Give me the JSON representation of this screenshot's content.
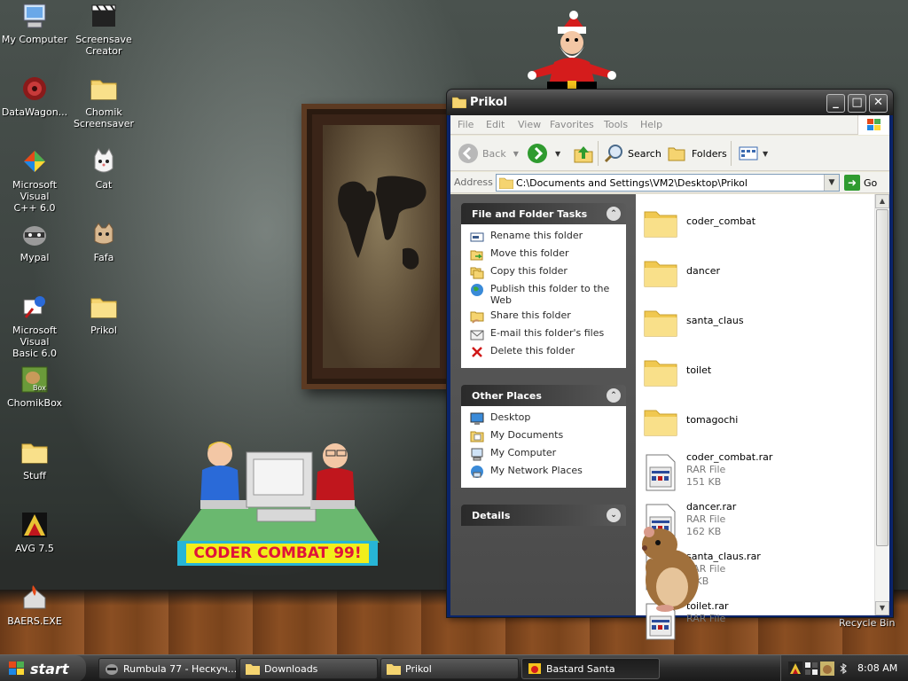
{
  "desktop": {
    "icons": [
      {
        "label": "My Computer",
        "icon": "my-computer-icon"
      },
      {
        "label": "Screensave\nCreator",
        "icon": "clapperboard-icon"
      },
      {
        "label": "DataWagon...",
        "icon": "datawagon-icon"
      },
      {
        "label": "Chomik\nScreensaver",
        "icon": "folder-icon"
      },
      {
        "label": "Microsoft Visual\nC++ 6.0",
        "icon": "visual-cpp-icon"
      },
      {
        "label": "Cat",
        "icon": "cat-icon"
      },
      {
        "label": "Mypal",
        "icon": "raccoon-icon"
      },
      {
        "label": "Fafa",
        "icon": "pet-icon"
      },
      {
        "label": "Microsoft Visual\nBasic 6.0",
        "icon": "visual-basic-icon"
      },
      {
        "label": "Prikol",
        "icon": "folder-icon"
      },
      {
        "label": "ChomikBox",
        "icon": "chomikbox-icon"
      },
      {
        "label": "Stuff",
        "icon": "folder-icon"
      },
      {
        "label": "AVG 7.5",
        "icon": "avg-icon"
      },
      {
        "label": "BAERS.EXE",
        "icon": "baers-icon"
      }
    ],
    "recycle_bin_label": "Recycle Bin",
    "combat_banner": "CODER COMBAT 99!"
  },
  "window": {
    "title": "Prikol",
    "menu": [
      "File",
      "Edit",
      "View",
      "Favorites",
      "Tools",
      "Help"
    ],
    "toolbar": {
      "back": "Back",
      "search": "Search",
      "folders": "Folders"
    },
    "address_label": "Address",
    "address_value": "C:\\Documents and Settings\\VM2\\Desktop\\Prikol",
    "go_label": "Go",
    "panels": {
      "file_tasks": {
        "title": "File and Folder Tasks",
        "items": [
          "Rename this folder",
          "Move this folder",
          "Copy this folder",
          "Publish this folder to the Web",
          "Share this folder",
          "E-mail this folder's files",
          "Delete this folder"
        ]
      },
      "other_places": {
        "title": "Other Places",
        "items": [
          "Desktop",
          "My Documents",
          "My Computer",
          "My Network Places"
        ]
      },
      "details": {
        "title": "Details"
      }
    },
    "files": [
      {
        "name": "coder_combat",
        "type": "folder"
      },
      {
        "name": "dancer",
        "type": "folder"
      },
      {
        "name": "santa_claus",
        "type": "folder"
      },
      {
        "name": "toilet",
        "type": "folder"
      },
      {
        "name": "tomagochi",
        "type": "folder"
      },
      {
        "name": "coder_combat.rar",
        "kind": "RAR File",
        "size": "151 KB",
        "type": "rar"
      },
      {
        "name": "dancer.rar",
        "kind": "RAR File",
        "size": "162 KB",
        "type": "rar"
      },
      {
        "name": "santa_claus.rar",
        "kind": "RAR File",
        "size": "3 KB",
        "type": "rar"
      },
      {
        "name": "toilet.rar",
        "kind": "RAR File",
        "size": "",
        "type": "rar"
      }
    ]
  },
  "taskbar": {
    "start_label": "start",
    "tasks": [
      {
        "label": "Rumbula 77 - Нескуч...",
        "active": false
      },
      {
        "label": "Downloads",
        "active": false
      },
      {
        "label": "Prikol",
        "active": false
      },
      {
        "label": "Bastard Santa",
        "active": true
      }
    ],
    "clock": "8:08 AM"
  },
  "colors": {
    "folder": "#f5d470",
    "link": "#2a2a2a",
    "banner_bg": "#27b5d6",
    "banner_text": "#e0133a",
    "banner_label_bg": "#f1ee1b"
  }
}
